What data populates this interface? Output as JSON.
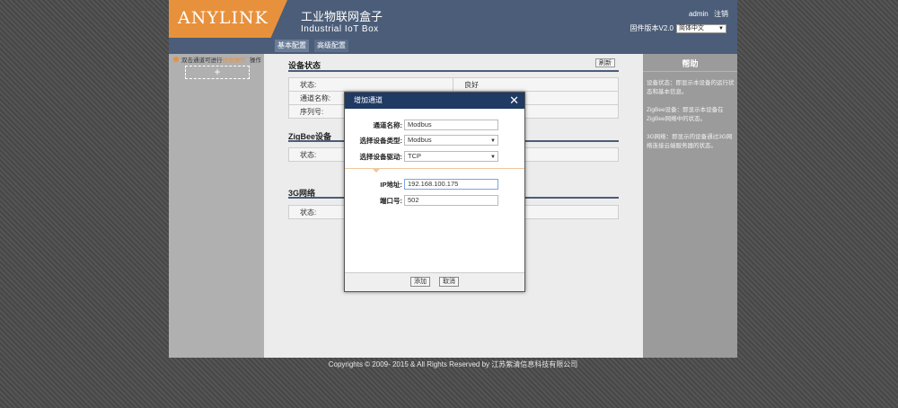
{
  "header": {
    "logo": "ANYLINK",
    "title_cn": "工业物联网盒子",
    "title_en": "Industrial  IoT Box",
    "user": "admin",
    "logout": "注销",
    "firmware": "固件版本V2.0",
    "language": "简体中文"
  },
  "tabs": [
    {
      "label": "基本配置"
    },
    {
      "label": "高级配置"
    }
  ],
  "sidebar": {
    "hint": "双击通道可进行",
    "hint_highlight": "修改操作",
    "op": "操作",
    "add": "+"
  },
  "main": {
    "refresh": "刷新",
    "device_status": {
      "title": "设备状态",
      "rows": [
        {
          "label": "状态:",
          "value": "良好"
        },
        {
          "label": "通道名称:",
          "value": ""
        },
        {
          "label": "序列号:",
          "value": ""
        }
      ]
    },
    "zigbee": {
      "title": "ZigBee设备",
      "rows": [
        {
          "label": "状态:",
          "value": ""
        }
      ]
    },
    "net3g": {
      "title": "3G网络",
      "rows": [
        {
          "label": "状态:",
          "value": ""
        }
      ]
    }
  },
  "help": {
    "title": "帮助",
    "items": [
      "设备状态：即显示本设备的运行状态和基本信息。",
      "ZigBee设备：即显示本设备在ZigBee网络中的状态。",
      "3G网络：即显示的设备通过3G网络连接云端服务器的状态。"
    ]
  },
  "footer": "Copyrights © 2009- 2015 & All Rights Reserved by 江苏紫清信息科技有限公司",
  "modal": {
    "title": "增加通道",
    "close": "✕",
    "fields": {
      "channel_name": {
        "label": "通道名称:",
        "value": "Modbus"
      },
      "device_type": {
        "label": "选择设备类型:",
        "value": "Modbus"
      },
      "driver": {
        "label": "选择设备驱动:",
        "value": "TCP"
      },
      "ip": {
        "label": "IP地址:",
        "value": "192.168.100.175"
      },
      "port": {
        "label": "端口号:",
        "value": "502"
      }
    },
    "add_button": "添加",
    "cancel_button": "取消"
  },
  "colors": {
    "header": "#4b5d78",
    "logo": "#e8913c",
    "modal_head": "#1f3a63"
  }
}
